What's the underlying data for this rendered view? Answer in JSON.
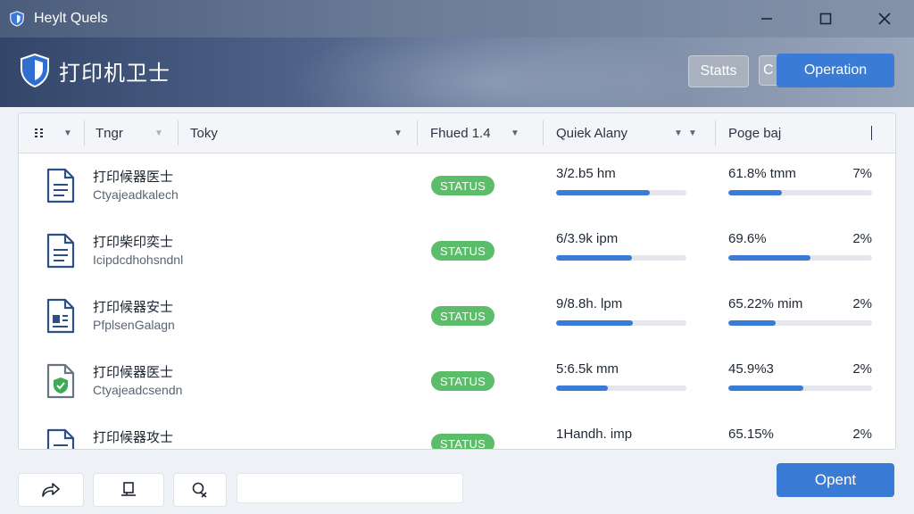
{
  "window": {
    "title": "Heylt Quels",
    "controls": [
      "minimize-icon",
      "maximize-icon",
      "close-icon"
    ]
  },
  "header": {
    "brand": "打印机卫士",
    "buttons": {
      "stats": "Statts",
      "partial": "C",
      "operation": "Operation"
    }
  },
  "table": {
    "columns": [
      {
        "label": "Tngr"
      },
      {
        "label": "Toky"
      },
      {
        "label": "Fhued 1.4"
      },
      {
        "label": "Quiek Alany"
      },
      {
        "label": "Poge baj"
      }
    ],
    "rows": [
      {
        "icon": "document-icon",
        "title": "打印候器医士",
        "subtitle": "Ctyajeadkalech",
        "status": "STATUS",
        "speed": "3/2.b5 hm",
        "speed_progress": 0.72,
        "quality": "61.8% tmm",
        "quality_progress": 0.37,
        "pct": "7%"
      },
      {
        "icon": "document-icon",
        "title": "打印柴印奕士",
        "subtitle": "Icipdcdhohsndnl",
        "status": "STATUS",
        "speed": "6/3.9k ipm",
        "speed_progress": 0.58,
        "quality": "69.6%",
        "quality_progress": 0.57,
        "pct": "2%"
      },
      {
        "icon": "document-chart-icon",
        "title": "打印候器安士",
        "subtitle": "PfplsenGalagn",
        "status": "STATUS",
        "speed": "9/8.8h. lpm",
        "speed_progress": 0.59,
        "quality": "65.22% mim",
        "quality_progress": 0.33,
        "pct": "2%"
      },
      {
        "icon": "document-shield-icon",
        "title": "打印候器医士",
        "subtitle": "Ctyajeadcsendn",
        "status": "STATUS",
        "speed": "5:6.5k mm",
        "speed_progress": 0.4,
        "quality": "45.9%3",
        "quality_progress": 0.52,
        "pct": "2%"
      },
      {
        "icon": "document-icon",
        "title": "打印候器攻士",
        "subtitle": "",
        "status": "STATUS",
        "speed": "1Handh. imp",
        "speed_progress": 0.0,
        "quality": "65.15%",
        "quality_progress": 0.0,
        "pct": "2%"
      }
    ]
  },
  "footer": {
    "buttons": [
      "share-icon",
      "printer-icon",
      "search-settings-icon"
    ],
    "input_value": "",
    "open_label": "Opent"
  },
  "colors": {
    "accent": "#3a7bd5",
    "status": "#5bbd6a",
    "header_dark": "#33466a"
  }
}
